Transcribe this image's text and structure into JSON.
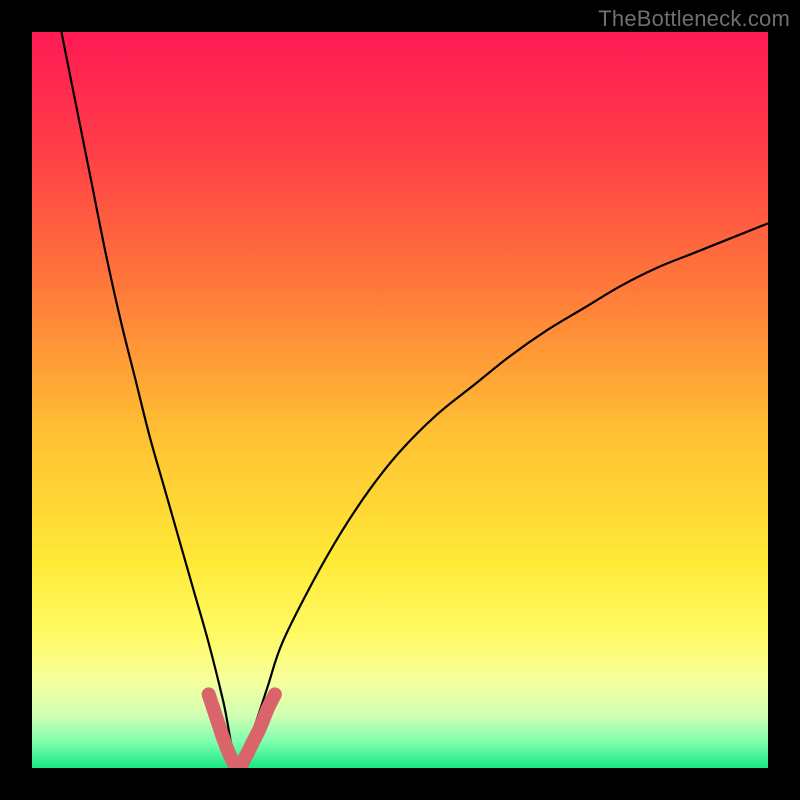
{
  "watermark": "TheBottleneck.com",
  "colors": {
    "frame": "#000000",
    "curve_main": "#000000",
    "curve_accent": "#d9646a",
    "watermark_text": "#6f6f6f",
    "gradient_stops": [
      {
        "offset": 0.0,
        "color": "#ff1a55"
      },
      {
        "offset": 0.15,
        "color": "#ff3b48"
      },
      {
        "offset": 0.35,
        "color": "#ff7a3a"
      },
      {
        "offset": 0.55,
        "color": "#ffc233"
      },
      {
        "offset": 0.72,
        "color": "#ffe937"
      },
      {
        "offset": 0.82,
        "color": "#fffb66"
      },
      {
        "offset": 0.88,
        "color": "#f6ff9a"
      },
      {
        "offset": 0.93,
        "color": "#cfffb4"
      },
      {
        "offset": 0.965,
        "color": "#7dffad"
      },
      {
        "offset": 1.0,
        "color": "#18e884"
      }
    ]
  },
  "chart_data": {
    "type": "line",
    "title": "",
    "xlabel": "",
    "ylabel": "",
    "xlim": [
      0,
      100
    ],
    "ylim": [
      0,
      100
    ],
    "notes": "V-shaped bottleneck curve; sharp minimum near x≈28, y≈0. Left branch rises steeply to y≈100 as x→4. Right branch rises more gradually to y≈74 at x=100. An accent (pink) highlight overlays the trough roughly x∈[24,33], y∈[0,10].",
    "series": [
      {
        "name": "main",
        "color": "#000000",
        "x": [
          4,
          6,
          8,
          10,
          12,
          14,
          16,
          18,
          20,
          22,
          24,
          26,
          28,
          30,
          32,
          34,
          38,
          42,
          46,
          50,
          55,
          60,
          65,
          70,
          75,
          80,
          85,
          90,
          95,
          100
        ],
        "y": [
          100,
          90,
          80,
          70,
          61,
          53,
          45,
          38,
          31,
          24,
          17,
          9,
          0,
          5,
          11,
          17,
          25,
          32,
          38,
          43,
          48,
          52,
          56,
          59.5,
          62.5,
          65.5,
          68,
          70,
          72,
          74
        ]
      },
      {
        "name": "accent-trough",
        "color": "#d9646a",
        "x": [
          24,
          25,
          26,
          27,
          28,
          29,
          30,
          31,
          32,
          33
        ],
        "y": [
          10,
          7,
          4,
          1.5,
          0,
          1.5,
          3.5,
          5.5,
          8,
          10
        ]
      }
    ],
    "background_gradient": {
      "direction": "vertical",
      "meaning": "green at bottom (good / no bottleneck) → red at top (severe bottleneck)"
    }
  }
}
